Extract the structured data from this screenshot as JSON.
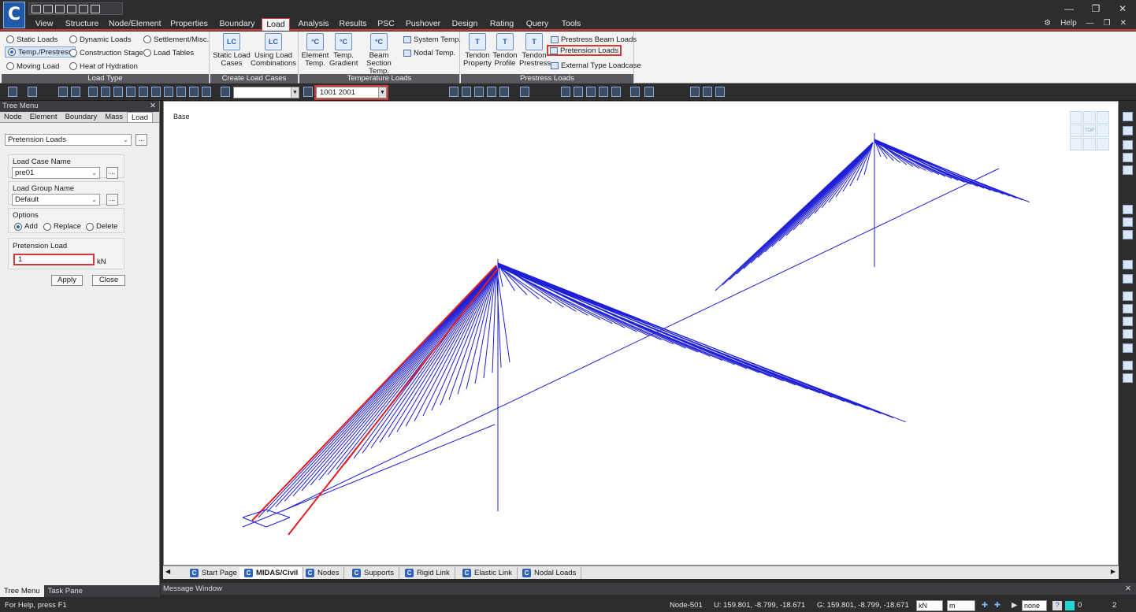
{
  "app": {
    "logo_text": "C"
  },
  "ribbon_tabs": [
    "View",
    "Structure",
    "Node/Element",
    "Properties",
    "Boundary",
    "Load",
    "Analysis",
    "Results",
    "PSC",
    "Pushover",
    "Design",
    "Rating",
    "Query",
    "Tools"
  ],
  "help_label": "Help",
  "ribbon": {
    "load_type": {
      "label": "Load Type",
      "items": [
        "Static Loads",
        "Dynamic Loads",
        "Settlement/Misc.",
        "Temp./Prestress",
        "Construction Stage",
        "Load Tables",
        "Moving Load",
        "Heat of Hydration"
      ]
    },
    "create_load_cases": {
      "label": "Create Load Cases",
      "static_load_cases": "Static Load Cases",
      "using_load_combinations": "Using Load Combinations"
    },
    "temperature_loads": {
      "label": "Temperature Loads",
      "element_temp": "Element Temp.",
      "temp_gradient": "Temp. Gradient",
      "beam_section_temp": "Beam Section Temp.",
      "system_temp": "System Temp.",
      "nodal_temp": "Nodal Temp."
    },
    "prestress_loads": {
      "label": "Prestress Loads",
      "tendon_property": "Tendon Property",
      "tendon_profile": "Tendon Profile",
      "tendon_prestress": "Tendon Prestress",
      "prestress_beam_loads": "Prestress Beam Loads",
      "pretension_loads": "Pretension Loads",
      "external_type_loadcase": "External Type Loadcase"
    }
  },
  "toolbar": {
    "selection_value": "1001 2001"
  },
  "tree_menu": {
    "title": "Tree Menu",
    "tabs": [
      "Node",
      "Element",
      "Boundary",
      "Mass",
      "Load"
    ],
    "load_type_select": "Pretension Loads",
    "load_case_label": "Load Case Name",
    "load_case_value": "pre01",
    "load_group_label": "Load Group Name",
    "load_group_value": "Default",
    "options_label": "Options",
    "options": [
      "Add",
      "Replace",
      "Delete"
    ],
    "pretension_label": "Pretension Load",
    "pretension_value": "1",
    "pretension_unit": "kN",
    "apply_label": "Apply",
    "close_label": "Close",
    "bottom_tabs": [
      "Tree Menu",
      "Task Pane"
    ]
  },
  "viewport": {
    "base_label": "Base",
    "navcube_label": "TOP"
  },
  "doc_tabs": [
    "Start Page",
    "MIDAS/Civil",
    "Nodes",
    "Supports",
    "Rigid Link",
    "Elastic Link",
    "Nodal Loads"
  ],
  "message_window": "Message Window",
  "statusbar": {
    "help_text": "For Help, press F1",
    "node": "Node-501",
    "u_coords": "U: 159.801, -8.799, -18.671",
    "g_coords": "G: 159.801, -8.799, -18.671",
    "force_unit": "kN",
    "length_unit": "m",
    "snap": "none",
    "count_a": "0",
    "count_b": "2"
  }
}
